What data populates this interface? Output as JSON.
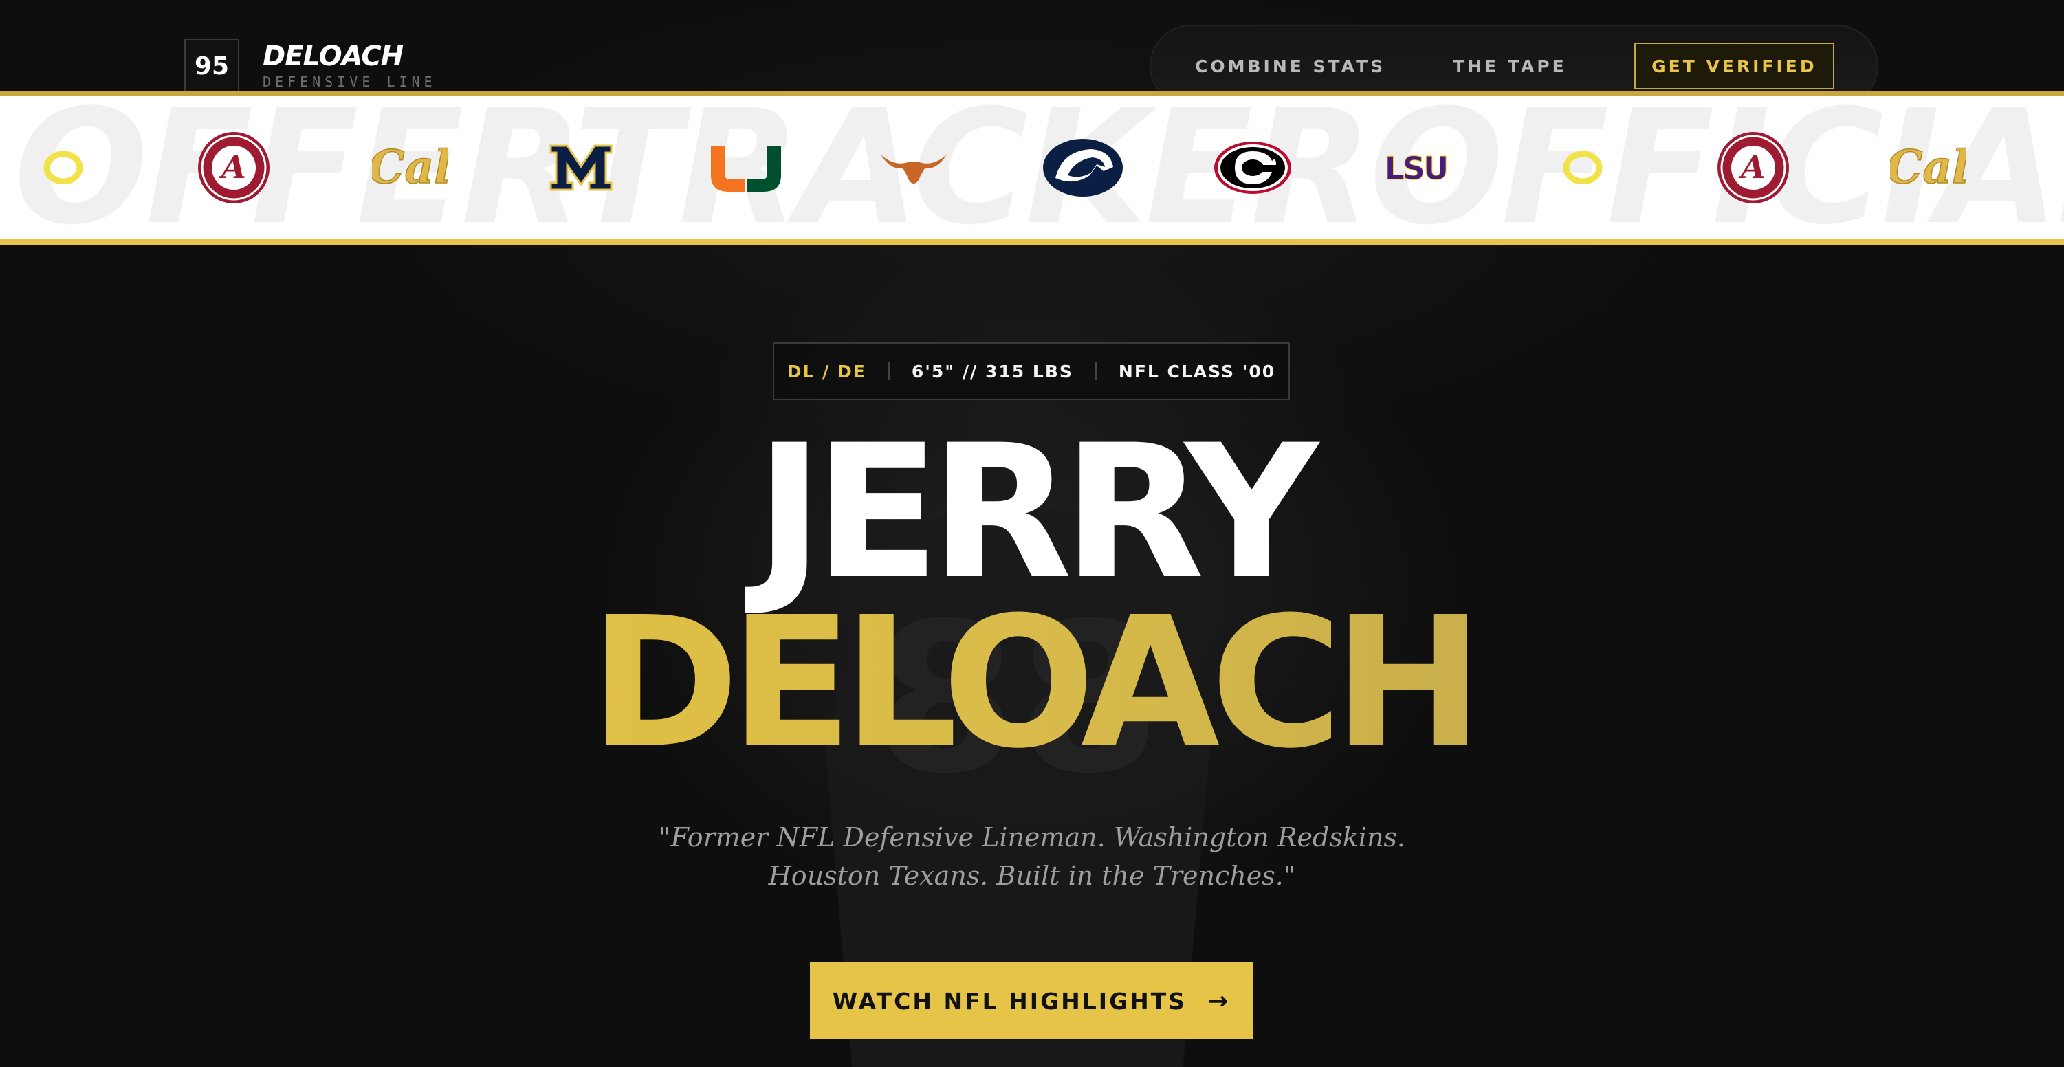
{
  "logo": {
    "number": "95",
    "name": "DELOACH",
    "subtitle": "DEFENSIVE LINE"
  },
  "nav": {
    "links": [
      "COMBINE STATS",
      "THE TAPE"
    ],
    "cta_label": "GET VERIFIED"
  },
  "ticker": {
    "background_text": "OFFERTRACKEROFFICIALOFFERTRACKER",
    "teams": [
      "oregon-icon",
      "alabama-icon",
      "cal-icon",
      "michigan-icon",
      "miami-icon",
      "texas-icon",
      "penn-state-icon",
      "georgia-icon",
      "lsu-icon",
      "oregon-icon",
      "alabama-icon",
      "cal-icon"
    ]
  },
  "hero": {
    "position": "DL / DE",
    "size": "6'5\" // 315 LBS",
    "class": "NFL CLASS '00",
    "first_name": "JERRY",
    "last_name": "DELOACH",
    "quote_line1": "\"Former NFL Defensive Lineman. Washington Redskins.",
    "quote_line2": "Houston Texans. Built in the Trenches.\"",
    "cta_label": "WATCH NFL HIGHLIGHTS",
    "cta_icon": "arrow-right-icon"
  },
  "colors": {
    "accent": "#e5c447",
    "background": "#0e0e0e"
  }
}
